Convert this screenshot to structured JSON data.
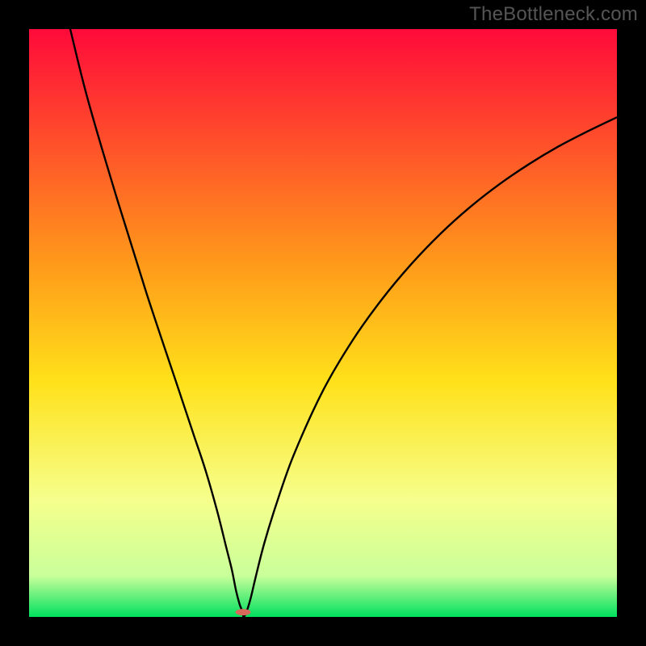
{
  "watermark": "TheBottleneck.com",
  "colors": {
    "frame": "#000000",
    "grad_top": "#ff0a3a",
    "grad_mid1": "#ff9a1a",
    "grad_mid2": "#ffe11a",
    "grad_mid3": "#f6ff8c",
    "grad_bottom_light": "#c9ff9a",
    "grad_bottom": "#00e05e",
    "curve": "#000000",
    "marker": "#d86a5b"
  },
  "chart_data": {
    "type": "line",
    "title": "",
    "xlabel": "",
    "ylabel": "",
    "xlim": [
      0,
      100
    ],
    "ylim": [
      0,
      100
    ],
    "series": [
      {
        "name": "curve",
        "x": [
          7,
          10,
          15,
          20,
          25,
          28,
          30,
          32,
          33.5,
          34.5,
          35.2,
          35.8,
          36.3,
          36.5,
          37,
          37.7,
          38.6,
          40,
          42,
          45,
          50,
          55,
          60,
          65,
          70,
          75,
          80,
          85,
          90,
          95,
          100
        ],
        "y": [
          100,
          88,
          71,
          55,
          40,
          31,
          25,
          18,
          12,
          8,
          4.5,
          2.2,
          0.9,
          0,
          0.9,
          3.2,
          7,
          12.5,
          19,
          27.5,
          38.5,
          47,
          54,
          60,
          65.2,
          69.7,
          73.6,
          77,
          80,
          82.6,
          85
        ]
      }
    ],
    "marker": {
      "x": 36.4,
      "y": 0.8,
      "rx": 1.3,
      "ry": 0.55
    },
    "gradient_stops": [
      {
        "offset": 0.0,
        "key": "grad_top"
      },
      {
        "offset": 0.4,
        "key": "grad_mid1"
      },
      {
        "offset": 0.6,
        "key": "grad_mid2"
      },
      {
        "offset": 0.8,
        "key": "grad_mid3"
      },
      {
        "offset": 0.93,
        "key": "grad_bottom_light"
      },
      {
        "offset": 1.0,
        "key": "grad_bottom"
      }
    ]
  }
}
